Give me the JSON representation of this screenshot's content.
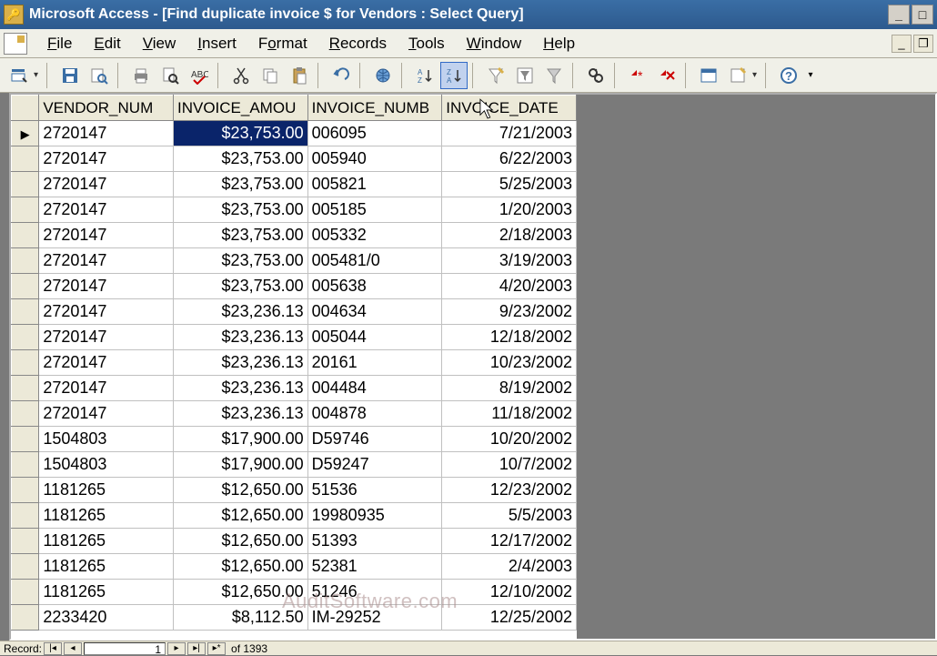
{
  "title": "Microsoft Access - [Find duplicate invoice $ for Vendors : Select Query]",
  "menus": {
    "file": "File",
    "edit": "Edit",
    "view": "View",
    "insert": "Insert",
    "format": "Format",
    "records": "Records",
    "tools": "Tools",
    "window": "Window",
    "help": "Help"
  },
  "headers": {
    "vendor_num": "VENDOR_NUM",
    "invoice_amount": "INVOICE_AMOU",
    "invoice_number": "INVOICE_NUMB",
    "invoice_date": "INVOICE_DATE"
  },
  "rows": [
    {
      "vendor_num": "2720147",
      "invoice_amount": "$23,753.00",
      "invoice_number": "006095",
      "invoice_date": "7/21/2003",
      "current": true,
      "selected_amount": true
    },
    {
      "vendor_num": "2720147",
      "invoice_amount": "$23,753.00",
      "invoice_number": "005940",
      "invoice_date": "6/22/2003"
    },
    {
      "vendor_num": "2720147",
      "invoice_amount": "$23,753.00",
      "invoice_number": "005821",
      "invoice_date": "5/25/2003"
    },
    {
      "vendor_num": "2720147",
      "invoice_amount": "$23,753.00",
      "invoice_number": "005185",
      "invoice_date": "1/20/2003"
    },
    {
      "vendor_num": "2720147",
      "invoice_amount": "$23,753.00",
      "invoice_number": "005332",
      "invoice_date": "2/18/2003"
    },
    {
      "vendor_num": "2720147",
      "invoice_amount": "$23,753.00",
      "invoice_number": "005481/0",
      "invoice_date": "3/19/2003"
    },
    {
      "vendor_num": "2720147",
      "invoice_amount": "$23,753.00",
      "invoice_number": "005638",
      "invoice_date": "4/20/2003"
    },
    {
      "vendor_num": "2720147",
      "invoice_amount": "$23,236.13",
      "invoice_number": "004634",
      "invoice_date": "9/23/2002"
    },
    {
      "vendor_num": "2720147",
      "invoice_amount": "$23,236.13",
      "invoice_number": "005044",
      "invoice_date": "12/18/2002"
    },
    {
      "vendor_num": "2720147",
      "invoice_amount": "$23,236.13",
      "invoice_number": "20161",
      "invoice_date": "10/23/2002"
    },
    {
      "vendor_num": "2720147",
      "invoice_amount": "$23,236.13",
      "invoice_number": "004484",
      "invoice_date": "8/19/2002"
    },
    {
      "vendor_num": "2720147",
      "invoice_amount": "$23,236.13",
      "invoice_number": "004878",
      "invoice_date": "11/18/2002"
    },
    {
      "vendor_num": "1504803",
      "invoice_amount": "$17,900.00",
      "invoice_number": "D59746",
      "invoice_date": "10/20/2002"
    },
    {
      "vendor_num": "1504803",
      "invoice_amount": "$17,900.00",
      "invoice_number": "D59247",
      "invoice_date": "10/7/2002"
    },
    {
      "vendor_num": "1181265",
      "invoice_amount": "$12,650.00",
      "invoice_number": "51536",
      "invoice_date": "12/23/2002"
    },
    {
      "vendor_num": "1181265",
      "invoice_amount": "$12,650.00",
      "invoice_number": "19980935",
      "invoice_date": "5/5/2003"
    },
    {
      "vendor_num": "1181265",
      "invoice_amount": "$12,650.00",
      "invoice_number": "51393",
      "invoice_date": "12/17/2002"
    },
    {
      "vendor_num": "1181265",
      "invoice_amount": "$12,650.00",
      "invoice_number": "52381",
      "invoice_date": "2/4/2003"
    },
    {
      "vendor_num": "1181265",
      "invoice_amount": "$12,650.00",
      "invoice_number": "51246",
      "invoice_date": "12/10/2002"
    },
    {
      "vendor_num": "2233420",
      "invoice_amount": "$8,112.50",
      "invoice_number": "IM-29252",
      "invoice_date": "12/25/2002"
    }
  ],
  "recnav": {
    "label": "Record:",
    "current": "1",
    "of_label": "of  1393"
  },
  "watermark": "AuditSoftware.com"
}
